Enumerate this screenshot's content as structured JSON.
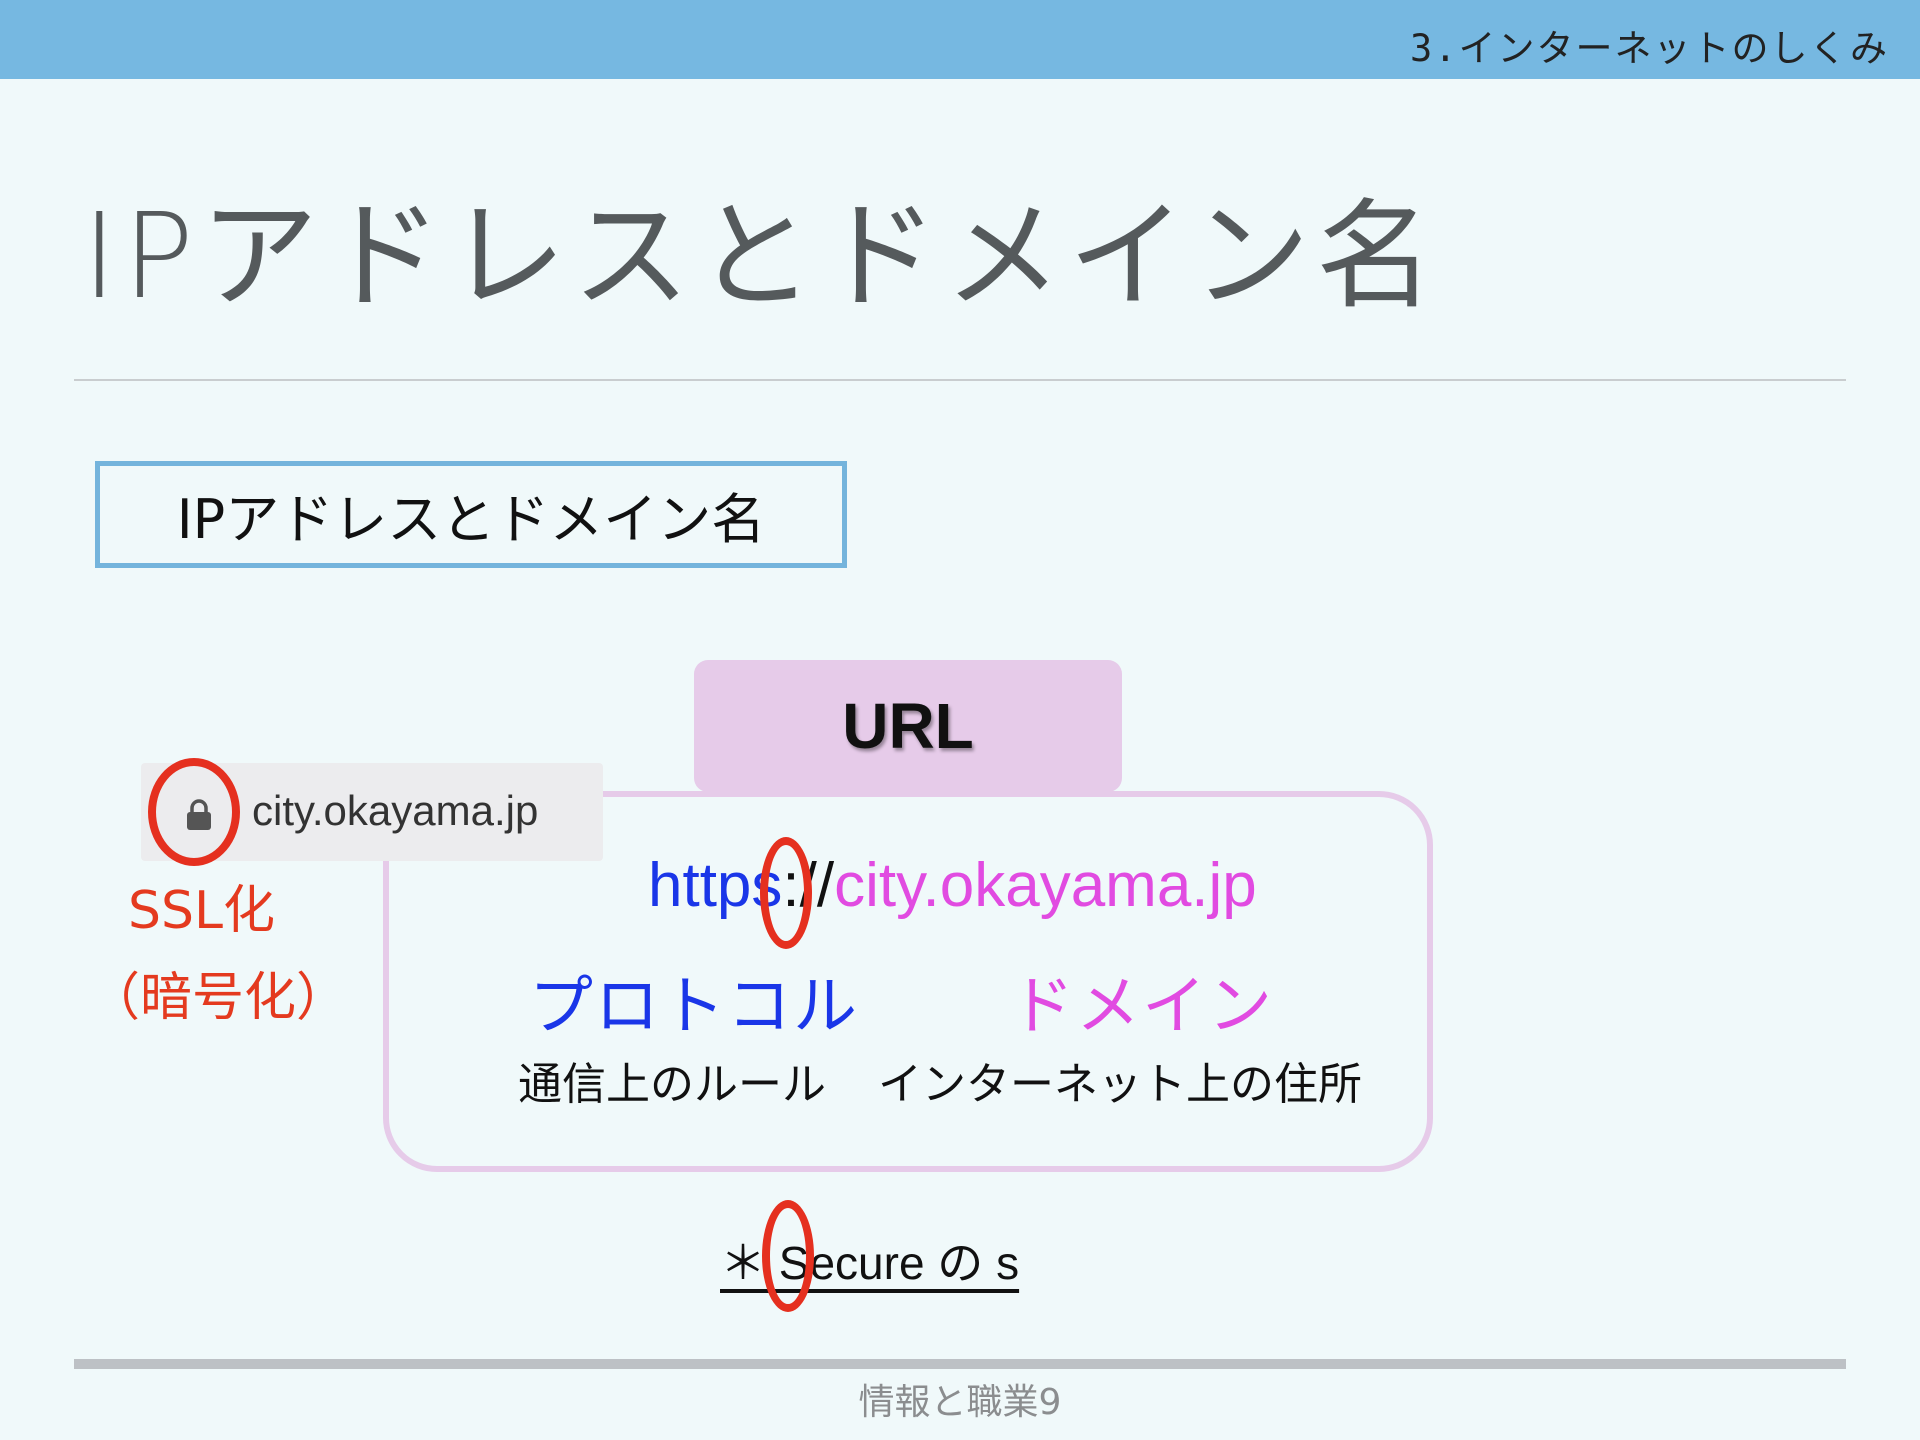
{
  "header": {
    "section_label": "3.インターネットのしくみ"
  },
  "slide": {
    "title": "IPアドレスとドメイン名",
    "section_box_label": "IPアドレスとドメイン名"
  },
  "url_diagram": {
    "tab_label": "URL",
    "scheme": "https",
    "separator": "://",
    "domain": "city.okayama.jp",
    "protocol_label": "プロトコル",
    "protocol_desc": "通信上のルール",
    "domain_label": "ドメイン",
    "domain_desc": "インターネット上の住所"
  },
  "address_bar": {
    "lock_icon": "lock-icon",
    "text": "city.okayama.jp"
  },
  "ssl": {
    "label": "SSL化",
    "sub_label": "（暗号化）"
  },
  "note": {
    "text": "＊ Secure の s"
  },
  "footer": {
    "text": "情報と職業9"
  },
  "colors": {
    "header_bar": "#76b8e1",
    "background": "#f0f9fa",
    "protocol_blue": "#1a36e8",
    "domain_magenta": "#e14be1",
    "highlight_red": "#e5301f",
    "url_panel": "#e6cbe9"
  }
}
